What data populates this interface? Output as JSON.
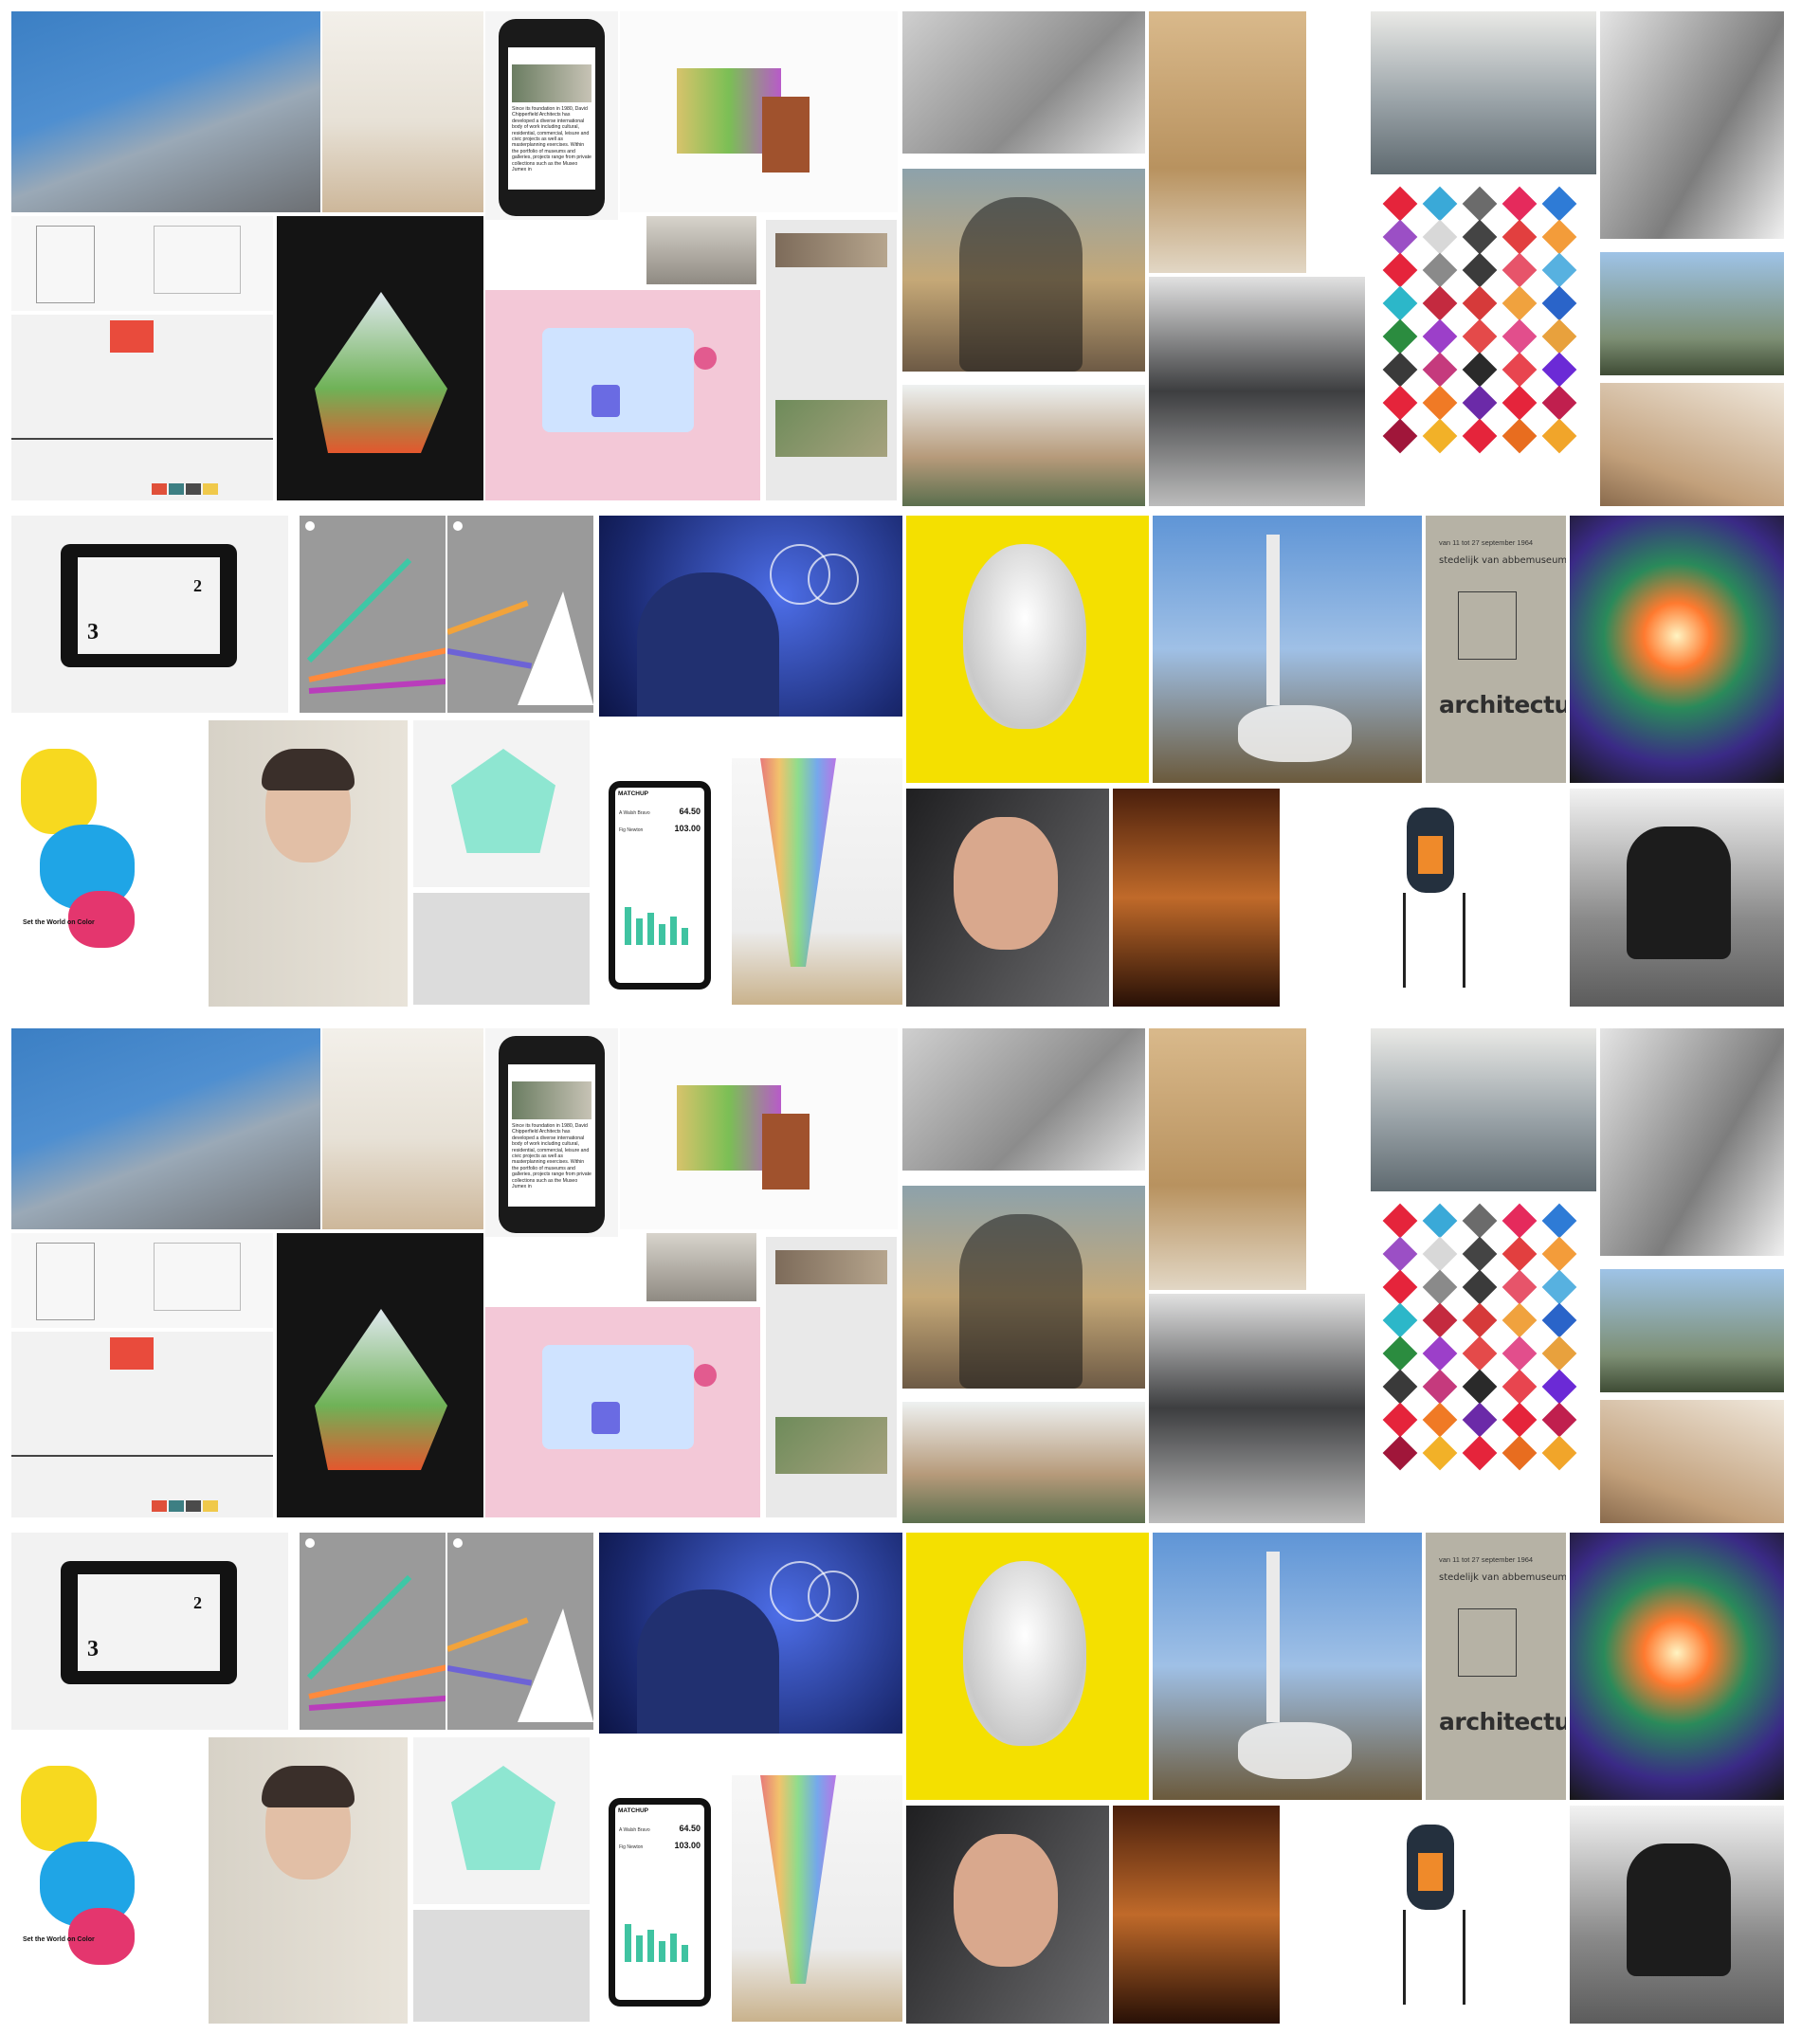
{
  "gallery": {
    "phone_screen_text": "Since its foundation in 1980, David Chipperfield Architects has developed a diverse international body of work including cultural, residential, commercial, leisure and civic projects as well as masterplanning exercises. Within the portfolio of museums and galleries, projects range from private collections such as the Museo Jumex in",
    "poster_text": "architectuur",
    "poster_museum": "stedelijk van abbemuseum eindhoven",
    "poster_dates": "van 11 tot 27 september 1964",
    "app_header": "MATCHUP",
    "app_value_1": "64.50",
    "app_value_2": "103.00",
    "app_name_1": "A Walsh Bravo",
    "app_name_2": "Fig Newton",
    "tagline": "Set the World on Color",
    "tablet_digits": [
      "3",
      "2"
    ],
    "heart_colors": [
      "#e5243b",
      "#3aa9d8",
      "#6b6b6b",
      "#e52a5c",
      "#2e7bd6",
      "#9b4fc5",
      "#d8d8d8",
      "#444444",
      "#e23f3f",
      "#f39c3a",
      "#e5243b",
      "#8a8a8a",
      "#3b3b3b",
      "#e7546a",
      "#57b1e0",
      "#2cb7c9",
      "#c42a3f",
      "#d63a3a",
      "#f0a23e",
      "#2a64c9",
      "#2b8c3f",
      "#9c3fc9",
      "#e44a4a",
      "#e24e8c",
      "#e8a13d",
      "#3a3a3a",
      "#c53a7d",
      "#2a2a2a",
      "#e8454f",
      "#6b2ad6",
      "#e5243b",
      "#f07a25",
      "#6b2aa8",
      "#e5243b",
      "#c01f4e",
      "#a0163a",
      "#f2b128",
      "#e5243b",
      "#e86d1f",
      "#f1a52a"
    ]
  }
}
